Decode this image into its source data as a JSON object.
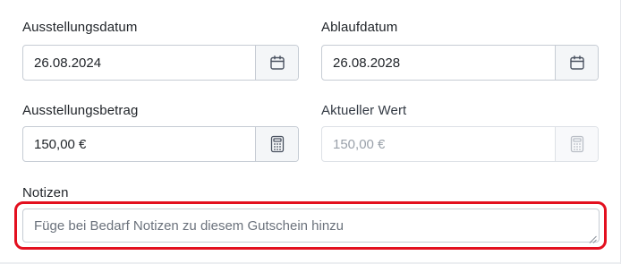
{
  "form": {
    "issue_date": {
      "label": "Ausstellungsdatum",
      "value": "26.08.2024",
      "icon": "calendar-icon"
    },
    "expiry_date": {
      "label": "Ablaufdatum",
      "value": "26.08.2028",
      "icon": "calendar-icon"
    },
    "issue_amount": {
      "label": "Ausstellungsbetrag",
      "value": "150,00 €",
      "icon": "calculator-icon"
    },
    "current_value": {
      "label": "Aktueller Wert",
      "value": "150,00 €",
      "icon": "calculator-icon",
      "disabled": true
    },
    "notes": {
      "label": "Notizen",
      "value": "",
      "placeholder": "Füge bei Bedarf Notizen zu diesem Gutschein hinzu"
    }
  },
  "colors": {
    "highlight": "#e3101f",
    "border": "#c6ccd4",
    "addon_background": "#f4f6f8",
    "text": "#1f2328",
    "muted_text": "#9aa1aa"
  }
}
